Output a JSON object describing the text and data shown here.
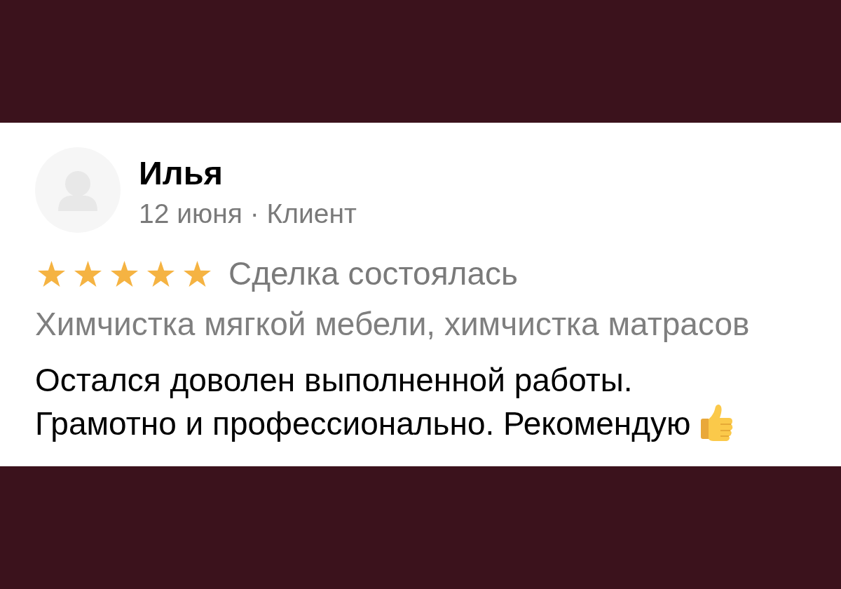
{
  "review": {
    "author": {
      "name": "Илья",
      "subtitle": "12 июня · Клиент"
    },
    "stars": 5,
    "deal_status": "Сделка состоялась",
    "service": "Химчистка мягкой мебели, химчистка матрасов",
    "text": "Остался доволен выполненной работы.\nГрамотно и профессионально. Рекомендую"
  }
}
